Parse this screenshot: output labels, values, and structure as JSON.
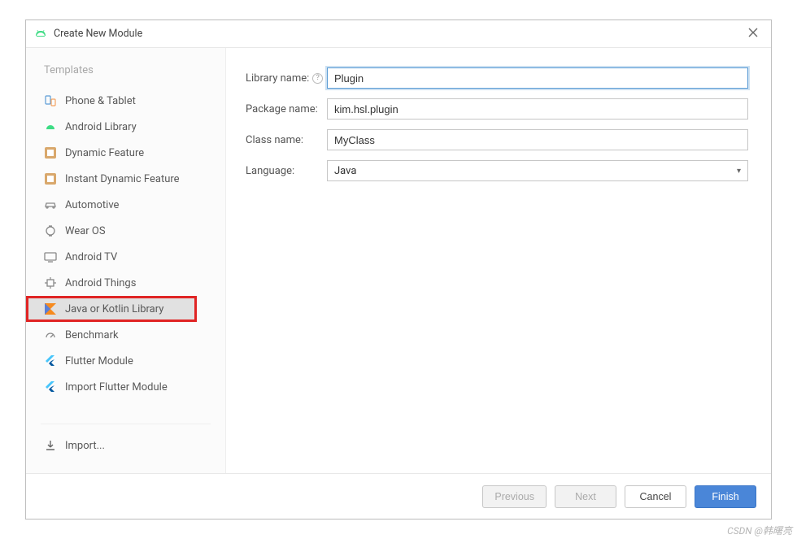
{
  "window": {
    "title": "Create New Module"
  },
  "sidebar": {
    "header": "Templates",
    "items": [
      {
        "label": "Phone & Tablet",
        "name": "template-phone-tablet",
        "icon": "phone-tablet-icon"
      },
      {
        "label": "Android Library",
        "name": "template-android-library",
        "icon": "android-icon"
      },
      {
        "label": "Dynamic Feature",
        "name": "template-dynamic-feature",
        "icon": "module-icon"
      },
      {
        "label": "Instant Dynamic Feature",
        "name": "template-instant-dynamic",
        "icon": "module-icon"
      },
      {
        "label": "Automotive",
        "name": "template-automotive",
        "icon": "car-icon"
      },
      {
        "label": "Wear OS",
        "name": "template-wear-os",
        "icon": "watch-icon"
      },
      {
        "label": "Android TV",
        "name": "template-android-tv",
        "icon": "tv-icon"
      },
      {
        "label": "Android Things",
        "name": "template-android-things",
        "icon": "things-icon"
      },
      {
        "label": "Java or Kotlin Library",
        "name": "template-java-kotlin-library",
        "icon": "kotlin-icon",
        "selected": true,
        "highlighted": true
      },
      {
        "label": "Benchmark",
        "name": "template-benchmark",
        "icon": "gauge-icon"
      },
      {
        "label": "Flutter Module",
        "name": "template-flutter-module",
        "icon": "flutter-icon"
      },
      {
        "label": "Import Flutter Module",
        "name": "template-import-flutter",
        "icon": "flutter-icon"
      }
    ],
    "import_label": "Import..."
  },
  "form": {
    "library_name": {
      "label": "Library name:",
      "value": "Plugin"
    },
    "package_name": {
      "label": "Package name:",
      "value": "kim.hsl.plugin"
    },
    "class_name": {
      "label": "Class name:",
      "value": "MyClass"
    },
    "language": {
      "label": "Language:",
      "value": "Java"
    }
  },
  "footer": {
    "previous": "Previous",
    "next": "Next",
    "cancel": "Cancel",
    "finish": "Finish"
  },
  "watermark": "CSDN @韩曙亮"
}
